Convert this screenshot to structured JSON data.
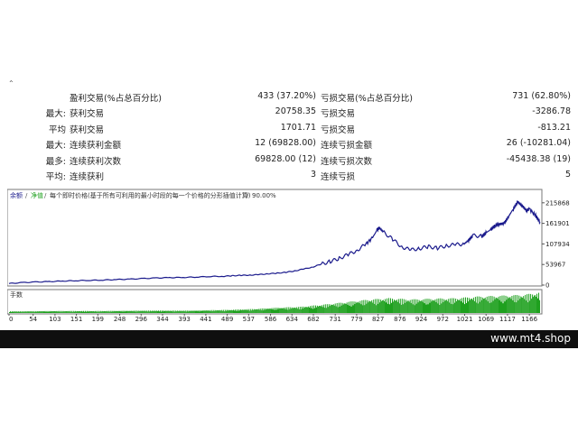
{
  "stats": {
    "rows": [
      {
        "l1": "",
        "l2": "盈利交易(%占总百分比)",
        "v1": "433 (37.20%)",
        "l3": "亏损交易(%占总百分比)",
        "v2": "731 (62.80%)"
      },
      {
        "l1": "最大:",
        "l2": "获利交易",
        "v1": "20758.35",
        "l3": "亏损交易",
        "v2": "-3286.78"
      },
      {
        "l1": "平均",
        "l2": "获利交易",
        "v1": "1701.71",
        "l3": "亏损交易",
        "v2": "-813.21"
      },
      {
        "l1": "最大:",
        "l2": "连续获利金额",
        "v1": "12 (69828.00)",
        "l3": "连续亏损金额",
        "v2": "26 (-10281.04)"
      },
      {
        "l1": "最多:",
        "l2": "连续获利次数",
        "v1": "69828.00 (12)",
        "l3": "连续亏损次数",
        "v2": "-45438.38 (19)"
      },
      {
        "l1": "平均:",
        "l2": "连续获利",
        "v1": "3",
        "l3": "连续亏损",
        "v2": "5"
      }
    ]
  },
  "chart": {
    "legend": {
      "balance": "余额",
      "sep1": "/",
      "equity": "净值",
      "sep2": "/",
      "desc": "每个即时价格(基于所有可利用的最小时段的每一个价格的分形插值计算)",
      "sep3": "/",
      "quality": "90.00%"
    },
    "volume_label": "手数",
    "colors": {
      "balance": "#1a1a8c",
      "volume": "#1ea01e",
      "axis": "#333333",
      "legend_balance": "#1a1a8c",
      "legend_equity": "#1ea01e"
    }
  },
  "chart_data": {
    "type": "line",
    "title": "",
    "xlabel": "",
    "ylabel": "",
    "x_ticks": [
      "0",
      "54",
      "103",
      "151",
      "199",
      "248",
      "296",
      "344",
      "393",
      "441",
      "489",
      "537",
      "586",
      "634",
      "682",
      "731",
      "779",
      "827",
      "876",
      "924",
      "972",
      "1021",
      "1069",
      "1117",
      "1166"
    ],
    "y_ticks": [
      "215868",
      "161901",
      "107934",
      "53967",
      "0"
    ],
    "xlim": [
      0,
      1190
    ],
    "ylim": [
      0,
      232000
    ],
    "series": [
      {
        "x": [
          0,
          30,
          60,
          90,
          120,
          150,
          180,
          210,
          240,
          270,
          300,
          330,
          360,
          390,
          420,
          450,
          480,
          500,
          520,
          540,
          560,
          580,
          600,
          620,
          640,
          660,
          680,
          700,
          720,
          740,
          760,
          780,
          800,
          815,
          825,
          830,
          840,
          860,
          880,
          900,
          920,
          940,
          960,
          980,
          1000,
          1020,
          1030,
          1040,
          1060,
          1070,
          1080,
          1090,
          1100,
          1110,
          1120,
          1130,
          1140,
          1150,
          1160,
          1166,
          1180,
          1190
        ],
        "y": [
          4000,
          6500,
          8000,
          9000,
          10500,
          11500,
          12500,
          13000,
          14500,
          15500,
          17000,
          18500,
          19500,
          20000,
          21000,
          22500,
          23000,
          24500,
          25500,
          26000,
          27500,
          29500,
          31000,
          33500,
          37000,
          42000,
          47000,
          55000,
          62000,
          70000,
          80000,
          91000,
          108000,
          125000,
          145000,
          150000,
          138000,
          120000,
          100000,
          92000,
          96000,
          101000,
          97000,
          103000,
          106000,
          108000,
          118000,
          130000,
          128000,
          138000,
          146000,
          157000,
          160000,
          162000,
          181000,
          200000,
          218000,
          208000,
          195000,
          200000,
          182000,
          165000
        ]
      }
    ],
    "volume": {
      "x": [
        0,
        100,
        200,
        300,
        400,
        500,
        550,
        600,
        650,
        700,
        750,
        800,
        850,
        900,
        950,
        1000,
        1050,
        1100,
        1150,
        1190
      ],
      "y": [
        0.4,
        0.5,
        0.5,
        0.6,
        0.6,
        0.8,
        1.0,
        1.3,
        1.5,
        2.0,
        2.6,
        3.2,
        3.6,
        3.3,
        3.5,
        3.6,
        4.0,
        4.2,
        4.4,
        5.0
      ]
    }
  },
  "footer": {
    "brand": "www.mt4.shop"
  }
}
